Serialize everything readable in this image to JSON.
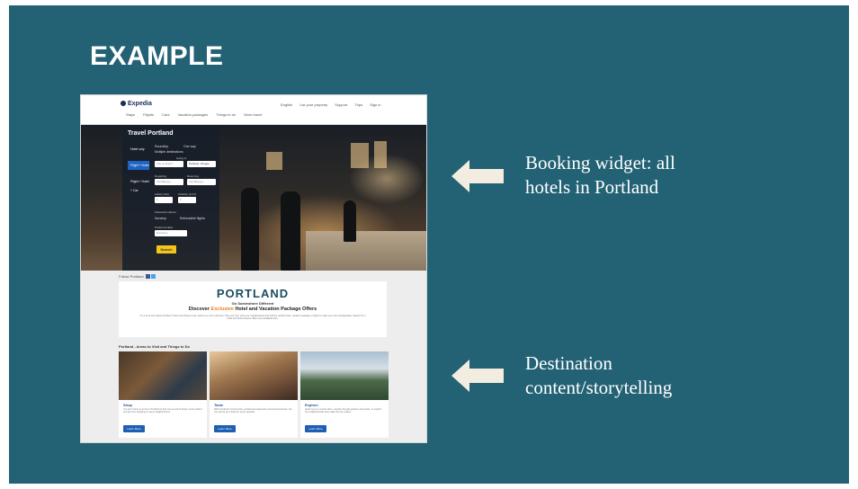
{
  "slide": {
    "title": "EXAMPLE",
    "background_color": "#236275",
    "callouts": [
      {
        "line1": "Booking widget: all",
        "line2": "hotels in Portland"
      },
      {
        "line1": "Destination",
        "line2": "content/storytelling"
      }
    ]
  },
  "screenshot": {
    "header": {
      "logo": "Expedia",
      "nav": [
        "Stays",
        "Flights",
        "Cars",
        "Vacation packages",
        "Things to do",
        "More travel"
      ],
      "links": [
        "English",
        "List your property",
        "Support",
        "Trips",
        "Sign in"
      ]
    },
    "widget": {
      "title": "Travel Portland",
      "tabs": [
        "Hotel only",
        "Flight + Hotel",
        "Flight + Hotel + Car"
      ],
      "radio_options": [
        "Roundtrip",
        "One way",
        "Multiple destinations"
      ],
      "going_to_label": "Going to",
      "leaving_from_placeholder": "City or airport",
      "going_to_value": "Portland, Oregon",
      "departing_label": "Departing",
      "returning_label": "Returning",
      "date_placeholder": "mm/dd/yyyy",
      "travelers_label": "Adults (18+)",
      "children_label": "Children (0-17)",
      "adults_value": "1",
      "children_value": "0",
      "advanced_label": "Advanced options",
      "nonstop_label": "Nonstop",
      "refundable_label": "Refundable flights",
      "class_label": "Preferred class",
      "class_value": "Economy",
      "search_button": "Search"
    },
    "follow": "Follow Portland",
    "promo": {
      "title": "PORTLAND",
      "subtitle": "Go Somewhere Different",
      "head_pre": "Discover",
      "head_accent": "Exclusive",
      "head_post": "Hotel and Vacation Package Offers",
      "body": "It's a lot to love about Portland. There are things to see, food to try, art to discover. Plan your trip, pick your neighborhood and find the perfect hotel, vacation package or flight to make your visit unforgettable. Search for a hotel and find exclusive offers only available here."
    },
    "areas_heading": "Portland - Areas to Visit and Things to Do",
    "cards": [
      {
        "title": "Shop",
        "text": "You don't have to go far in Portland to find one-of-a-kind shops, local makers and tax-free shopping in every neighborhood.",
        "button": "Learn More"
      },
      {
        "title": "Taste",
        "text": "With hundreds of food carts, acclaimed restaurants and local breweries, the city serves up a feast for every appetite.",
        "button": "Learn More"
      },
      {
        "title": "Explore",
        "text": "Head out on a scenic drive, wander through gardens and parks, or explore the neighborhoods that make the city unique.",
        "button": "Learn More"
      }
    ]
  }
}
